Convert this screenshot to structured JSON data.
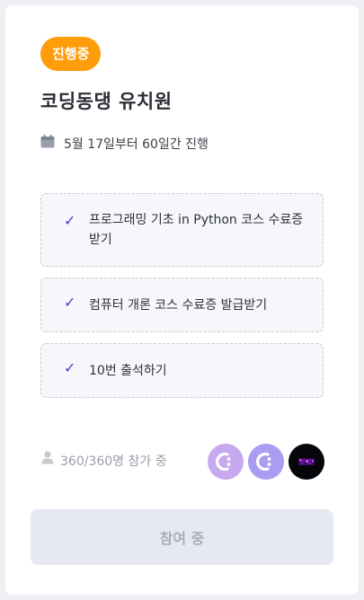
{
  "challenge": {
    "status_badge": "진행중",
    "title": "코딩동댕 유치원",
    "period": "5월 17일부터 60일간 진행",
    "missions": [
      {
        "check": "✓",
        "text": "프로그래밍 기초 in Python 코스 수료증 받기"
      },
      {
        "check": "✓",
        "text": "컴퓨터 개론 코스 수료증 발급받기"
      },
      {
        "check": "✓",
        "text": "10번 출석하기"
      }
    ],
    "participants": "360/360명 참가 중",
    "join_button": "참여 중"
  },
  "colors": {
    "badge": "#ff9c0a",
    "check": "#6b2bd1",
    "button_bg": "#e6e9f2",
    "button_text": "#a8adb9"
  },
  "icons": {
    "period": "calendar-icon",
    "participants": "person-icon"
  }
}
